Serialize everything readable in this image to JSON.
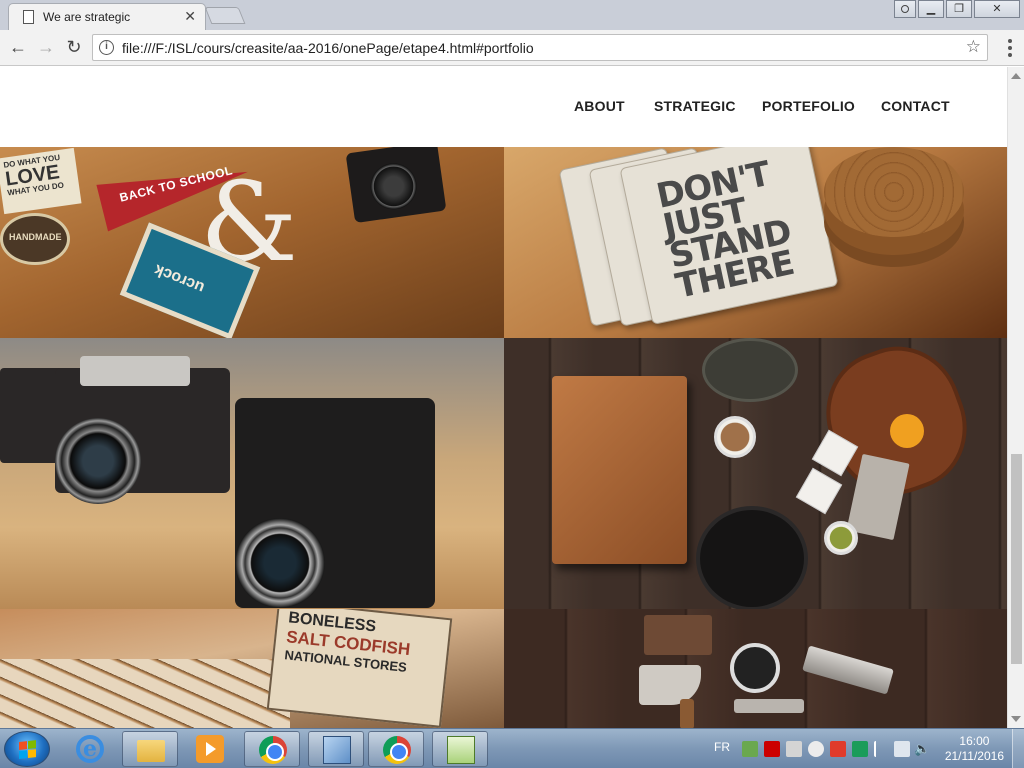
{
  "browser": {
    "tab_title": "We are strategic",
    "tab_close": "✕",
    "url": "file:///F:/ISL/cours/creasite/aa-2016/onePage/etape4.html#portfolio",
    "window_buttons": [
      "▁",
      "❐",
      "✕"
    ]
  },
  "nav": {
    "links": [
      "ABOUT",
      "STRATEGIC",
      "PORTEFOLIO",
      "CONTACT"
    ]
  },
  "portfolio": {
    "tile1": {
      "pennant": "BACK TO SCHOOL",
      "card": "ucrock",
      "love_card": [
        "DO WHAT YOU",
        "LOVE",
        "WHAT YOU DO"
      ],
      "badge": "HANDMADE"
    },
    "tile2": {
      "notebook": "DON'T JUST STAND THERE"
    },
    "tile5": {
      "sign": [
        "BONELESS",
        "SALT CODFISH",
        "NATIONAL STORES"
      ]
    }
  },
  "taskbar": {
    "lang": "FR",
    "time": "16:00",
    "date": "21/11/2016"
  },
  "colors": {
    "nav_text": "#222222",
    "page_bg": "#ffffff",
    "taskbar": "#7e98b6"
  }
}
